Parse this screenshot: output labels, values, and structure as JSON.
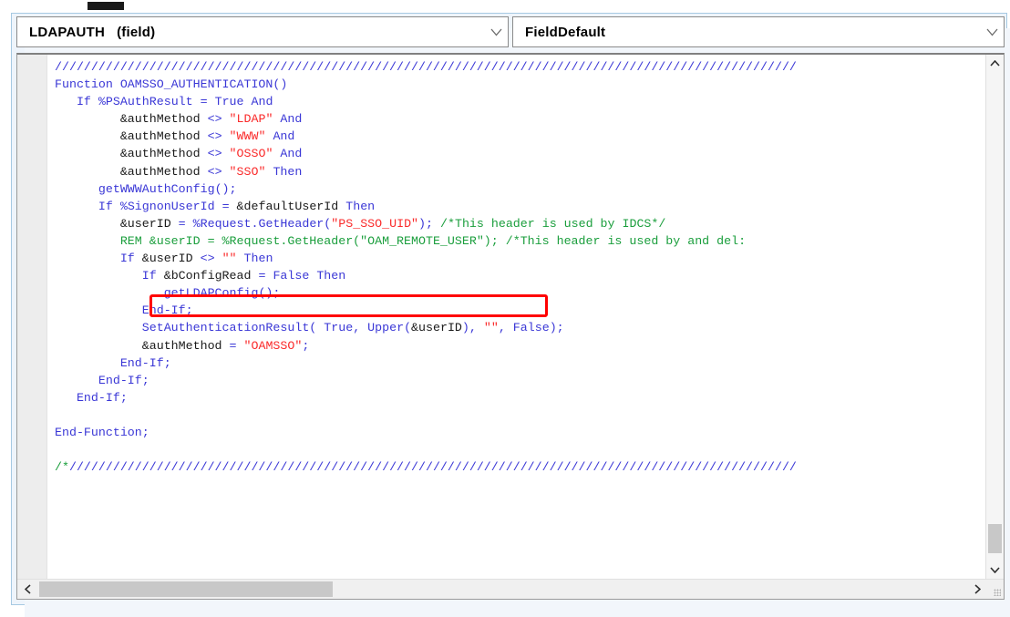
{
  "window": {
    "accent_color": "#a6c9e2",
    "frame_bg": "#eef4fb"
  },
  "toolbar": {
    "object_combo": {
      "value": "LDAPAUTH   (field)",
      "arrow_icon": "chevron-down-icon"
    },
    "event_combo": {
      "value": "FieldDefault",
      "arrow_icon": "chevron-down-icon"
    }
  },
  "editor": {
    "language": "PeopleCode",
    "colors": {
      "keyword": "#3a37d6",
      "string": "#fa2a2a",
      "comment": "#1a9e3c",
      "plain": "#1a1a1a"
    },
    "annotation": {
      "shape": "rectangle",
      "color": "#ff0000",
      "targets_line": "&userID = %Request.GetHeader(\"PS_SSO_UID\");"
    },
    "lines": [
      "//////////////////////////////////////////////////////////////////////////////////////////////////////",
      "Function OAMSSO_AUTHENTICATION()",
      "   If %PSAuthResult = True And",
      "         &authMethod <> \"LDAP\" And",
      "         &authMethod <> \"WWW\" And",
      "         &authMethod <> \"OSSO\" And",
      "         &authMethod <> \"SSO\" Then",
      "      getWWWAuthConfig();",
      "      If %SignonUserId = &defaultUserId Then",
      "         &userID = %Request.GetHeader(\"PS_SSO_UID\"); /*This header is used by IDCS*/",
      "         REM &userID = %Request.GetHeader(\"OAM_REMOTE_USER\"); /*This header is used by and del:",
      "         If &userID <> \"\" Then",
      "            If &bConfigRead = False Then",
      "               getLDAPConfig();",
      "            End-If;",
      "            SetAuthenticationResult( True, Upper(&userID), \"\", False);",
      "            &authMethod = \"OAMSSO\";",
      "         End-If;",
      "      End-If;",
      "   End-If;",
      "",
      "End-Function;",
      "",
      "/*////////////////////////////////////////////////////////////////////////////////////////////////////"
    ]
  },
  "scrollbars": {
    "vertical": {
      "up_icon": "chevron-up-icon",
      "down_icon": "chevron-down-icon",
      "thumb_position": "near-bottom"
    },
    "horizontal": {
      "left_icon": "chevron-left-icon",
      "right_icon": "chevron-right-icon",
      "thumb_position": "left"
    },
    "resize_grip_icon": "resize-grip-icon"
  }
}
